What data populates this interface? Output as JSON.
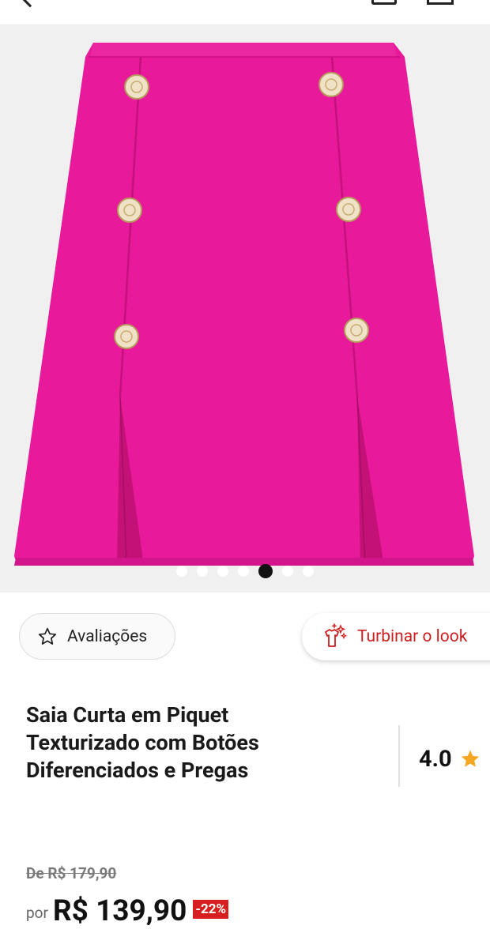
{
  "header": {
    "icons": [
      "back-arrow-icon",
      "bag-icon",
      "share-icon"
    ]
  },
  "gallery": {
    "image_subject": "pink mini skirt with gold buttons",
    "image_count": 7,
    "active_index": 4
  },
  "actions": {
    "reviews_label": "Avaliações",
    "reviews_icon": "star-outline-icon",
    "look_label": "Turbinar o look",
    "look_icon": "sparkle-shirt-icon"
  },
  "product": {
    "title": "Saia Curta em Piquet Texturizado com Botões Diferenciados e Pregas",
    "rating": "4.0",
    "rating_icon": "star-icon"
  },
  "pricing": {
    "old_price": "De R$ 179,90",
    "prefix": "por",
    "price": "R$ 139,90",
    "discount": "-22%"
  },
  "colors": {
    "accent_red": "#cc1f1f",
    "badge_red": "#d81f1f",
    "skirt_pink": "#e8199a",
    "star_gold": "#f5a623"
  }
}
